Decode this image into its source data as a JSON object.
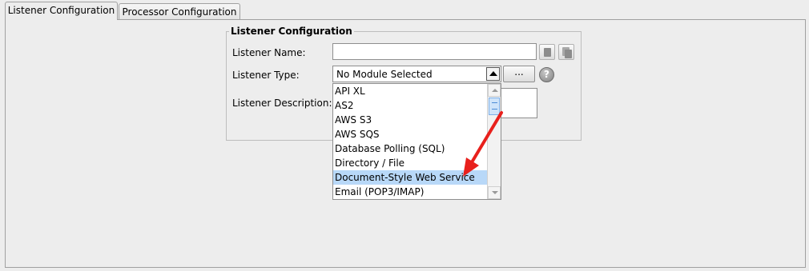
{
  "tabs": [
    {
      "label": "Listener Configuration",
      "active": true
    },
    {
      "label": "Processor Configuration",
      "active": false
    }
  ],
  "group": {
    "title": "Listener Configuration",
    "name_label": "Listener Name:",
    "name_value": "",
    "type_label": "Listener Type:",
    "type_selected": "No Module Selected",
    "browse_label": "...",
    "help_label": "?",
    "description_label": "Listener Description:",
    "description_value": ""
  },
  "dropdown": {
    "items": [
      "API XL",
      "AS2",
      "AWS S3",
      "AWS SQS",
      "Database Polling (SQL)",
      "Directory / File",
      "Document-Style Web Service",
      "Email (POP3/IMAP)"
    ],
    "highlighted": "Document-Style Web Service"
  },
  "icons": {
    "copy": "copy-icon",
    "paste": "paste-icon",
    "help": "help-icon",
    "annotation": "red-arrow-annotation"
  },
  "colors": {
    "highlight": "#b8d8f8",
    "arrow": "#e8201c"
  }
}
